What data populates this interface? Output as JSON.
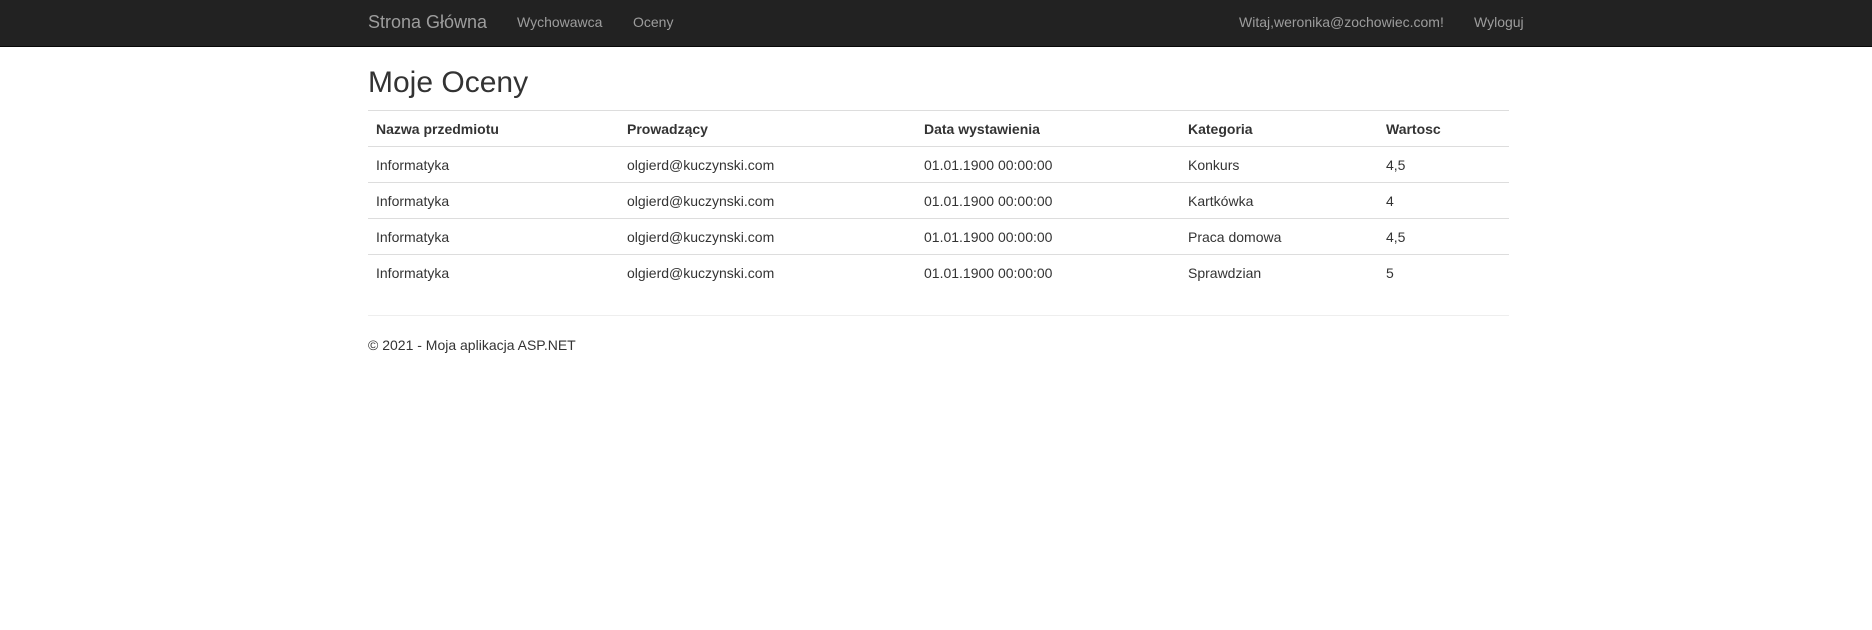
{
  "navbar": {
    "brand": "Strona Główna",
    "links": [
      {
        "label": "Wychowawca"
      },
      {
        "label": "Oceny"
      }
    ],
    "greeting": "Witaj,weronika@zochowiec.com!",
    "logout": "Wyloguj"
  },
  "main": {
    "title": "Moje Oceny",
    "table": {
      "headers": [
        "Nazwa przedmiotu",
        "Prowadzący",
        "Data wystawienia",
        "Kategoria",
        "Wartosc"
      ],
      "rows": [
        [
          "Informatyka",
          "olgierd@kuczynski.com",
          "01.01.1900 00:00:00",
          "Konkurs",
          "4,5"
        ],
        [
          "Informatyka",
          "olgierd@kuczynski.com",
          "01.01.1900 00:00:00",
          "Kartkówka",
          "4"
        ],
        [
          "Informatyka",
          "olgierd@kuczynski.com",
          "01.01.1900 00:00:00",
          "Praca domowa",
          "4,5"
        ],
        [
          "Informatyka",
          "olgierd@kuczynski.com",
          "01.01.1900 00:00:00",
          "Sprawdzian",
          "5"
        ]
      ]
    }
  },
  "footer": {
    "text": "© 2021 - Moja aplikacja ASP.NET"
  },
  "colors": {
    "navbar_bg": "#222222",
    "nav_text": "#9d9d9d",
    "body_text": "#333333",
    "table_border": "#dddddd"
  }
}
